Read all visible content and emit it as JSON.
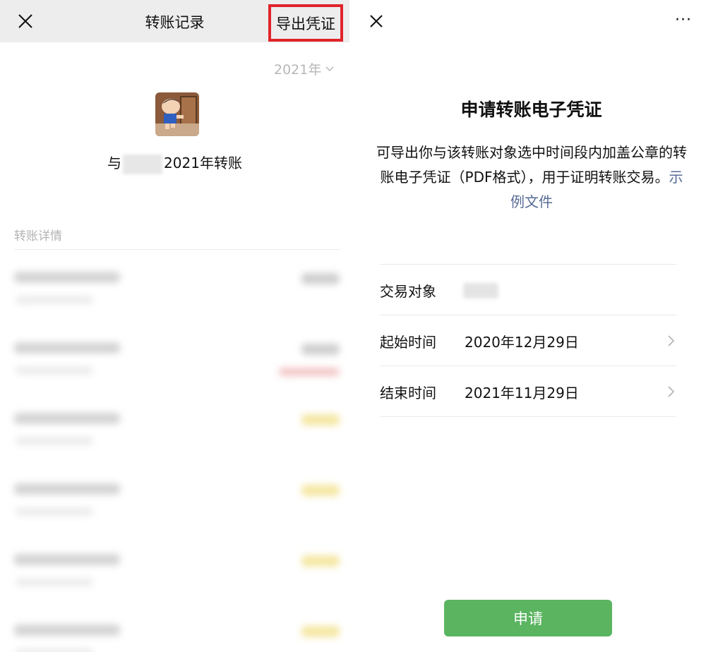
{
  "left": {
    "header": {
      "title": "转账记录",
      "export_label": "导出凭证"
    },
    "year_selector": "2021年",
    "with_prefix": "与",
    "with_suffix": "2021年转账",
    "section_label": "转账详情",
    "records_count_visible": 6
  },
  "right": {
    "more_label": "···",
    "heading": "申请转账电子凭证",
    "description": "可导出你与该转账对象选中时间段内加盖公章的转账电子凭证（PDF格式），用于证明转账交易。",
    "sample_link": "示例文件",
    "rows": {
      "counterparty_label": "交易对象",
      "start_label": "起始时间",
      "start_value": "2020年12月29日",
      "end_label": "结束时间",
      "end_value": "2021年11月29日"
    },
    "apply_button": "申请"
  },
  "colors": {
    "highlight_border": "#e0242b",
    "header_bg": "#ededed",
    "link": "#576b95",
    "primary_button": "#5ab460"
  },
  "icons": {
    "left_close": "close-icon",
    "year_dropdown": "chevron-down-icon",
    "right_close": "close-icon",
    "more": "more-icon",
    "row_chevron": "chevron-right-icon"
  }
}
